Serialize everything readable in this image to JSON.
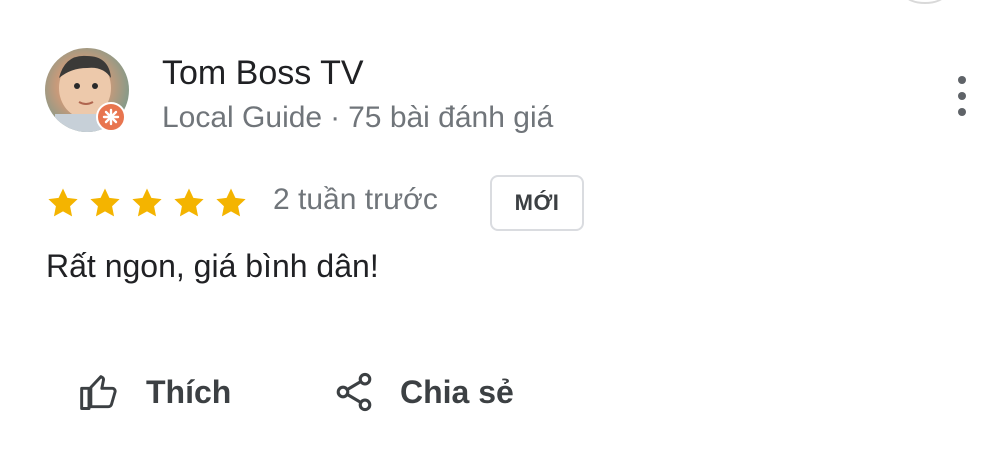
{
  "review": {
    "author": "Tom Boss TV",
    "guide_label": "Local Guide",
    "separator": "·",
    "review_count": "75 bài đánh giá",
    "rating": 5,
    "rating_max": 5,
    "time": "2 tuần trước",
    "badge": "MỚI",
    "text": "Rất ngon, giá bình dân!"
  },
  "actions": {
    "like_label": "Thích",
    "share_label": "Chia sẻ"
  },
  "colors": {
    "star": "#f4b400",
    "guide_badge": "#e8754f",
    "secondary_text": "#70757a"
  }
}
